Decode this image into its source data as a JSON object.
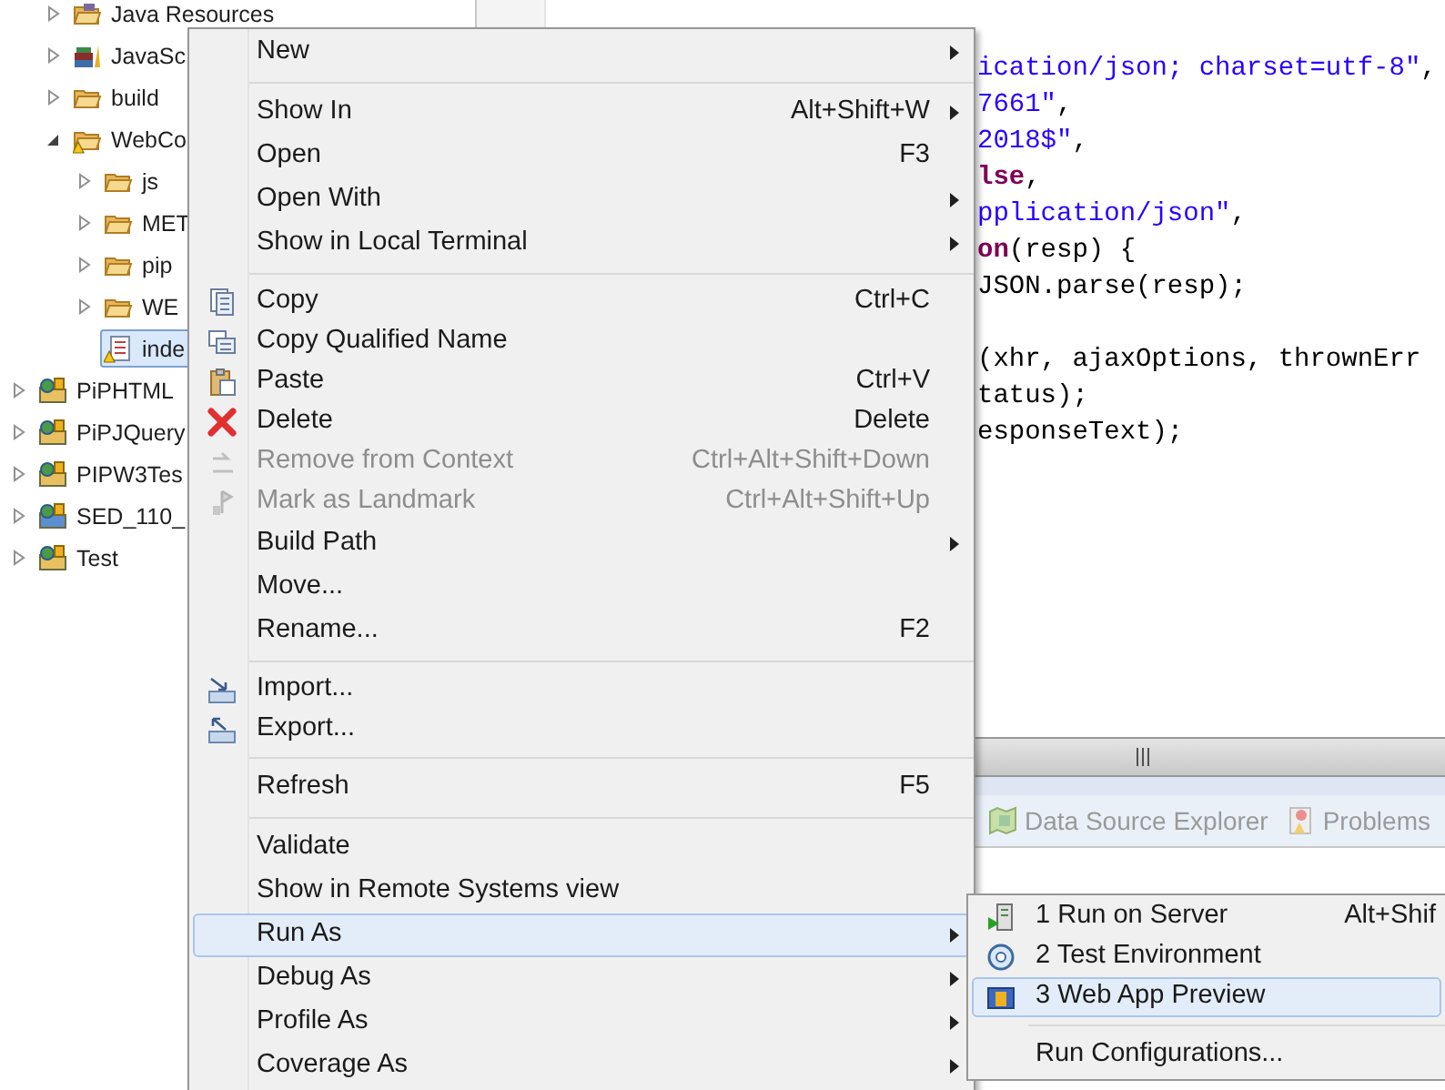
{
  "tree": {
    "project_contents": [
      {
        "label": "Java Resources",
        "kind": "java-resources",
        "expanded": false,
        "selected": false
      },
      {
        "label": "JavaSc",
        "kind": "library",
        "expanded": false,
        "selected": false
      },
      {
        "label": "build",
        "kind": "folder",
        "expanded": false,
        "selected": false
      },
      {
        "label": "WebCo",
        "kind": "warn-folder",
        "expanded": true,
        "selected": false,
        "children": [
          {
            "label": "js",
            "kind": "folder",
            "expanded": false,
            "selected": false
          },
          {
            "label": "MET",
            "kind": "folder",
            "expanded": false,
            "selected": false
          },
          {
            "label": "pip",
            "kind": "folder",
            "expanded": false,
            "selected": false
          },
          {
            "label": "WE",
            "kind": "folder",
            "expanded": false,
            "selected": false
          },
          {
            "label": "inde",
            "kind": "file",
            "selected": true
          }
        ]
      }
    ],
    "projects": [
      {
        "label": "PiPHTML",
        "kind": "project",
        "expanded": false,
        "selected": false
      },
      {
        "label": "PiPJQuery",
        "kind": "project",
        "expanded": false,
        "selected": false
      },
      {
        "label": "PIPW3Tes",
        "kind": "project",
        "expanded": false,
        "selected": false
      },
      {
        "label": "SED_110_",
        "kind": "project-alt",
        "expanded": false,
        "selected": false
      },
      {
        "label": "Test",
        "kind": "project",
        "expanded": false,
        "selected": false
      }
    ]
  },
  "editor": {
    "upper_lines": [
      [
        {
          "kind": "string",
          "text": "ication/json; charset=utf-8\""
        },
        {
          "kind": "plain",
          "text": ","
        }
      ],
      [
        {
          "kind": "string",
          "text": "7661\""
        },
        {
          "kind": "plain",
          "text": ","
        }
      ],
      [
        {
          "kind": "string",
          "text": "2018$\""
        },
        {
          "kind": "plain",
          "text": ","
        }
      ],
      [
        {
          "kind": "keyword",
          "text": "lse"
        },
        {
          "kind": "plain",
          "text": ","
        }
      ],
      [
        {
          "kind": "string",
          "text": "pplication/json\""
        },
        {
          "kind": "plain",
          "text": ","
        }
      ],
      [
        {
          "kind": "keyword",
          "text": "on"
        },
        {
          "kind": "plain",
          "text": "(resp) {"
        }
      ],
      [
        {
          "kind": "plain",
          "text": "JSON.parse(resp);"
        }
      ]
    ],
    "lower_lines": [
      [
        {
          "kind": "plain",
          "text": "(xhr, ajaxOptions, thrownErr"
        }
      ],
      [
        {
          "kind": "plain",
          "text": "tatus);"
        }
      ],
      [
        {
          "kind": "plain",
          "text": "esponseText);"
        }
      ]
    ]
  },
  "views": {
    "tabs": [
      {
        "label": "Data Source Explorer",
        "kind": "database"
      },
      {
        "label": "Problems",
        "kind": "problems"
      }
    ]
  },
  "context_menu": [
    {
      "kind": "item",
      "label": "New",
      "submenu": true,
      "disabled": false,
      "selected": false
    },
    {
      "kind": "separator"
    },
    {
      "kind": "item",
      "label": "Show In",
      "shortcut": "Alt+Shift+W",
      "submenu": true,
      "disabled": false,
      "selected": false
    },
    {
      "kind": "item",
      "label": "Open",
      "shortcut": "F3",
      "submenu": false,
      "disabled": false,
      "selected": false
    },
    {
      "kind": "item",
      "label": "Open With",
      "submenu": true,
      "disabled": false,
      "selected": false
    },
    {
      "kind": "item",
      "label": "Show in Local Terminal",
      "submenu": true,
      "disabled": false,
      "selected": false
    },
    {
      "kind": "separator"
    },
    {
      "kind": "item",
      "label": "Copy",
      "shortcut": "Ctrl+C",
      "submenu": false,
      "disabled": false,
      "selected": false
    },
    {
      "kind": "item",
      "label": "Copy Qualified Name",
      "submenu": false,
      "disabled": false,
      "selected": false
    },
    {
      "kind": "item",
      "label": "Paste",
      "shortcut": "Ctrl+V",
      "submenu": false,
      "disabled": false,
      "selected": false
    },
    {
      "kind": "item",
      "label": "Delete",
      "shortcut": "Delete",
      "submenu": false,
      "disabled": false,
      "selected": false
    },
    {
      "kind": "item",
      "label": "Remove from Context",
      "shortcut": "Ctrl+Alt+Shift+Down",
      "submenu": false,
      "disabled": true,
      "selected": false
    },
    {
      "kind": "item",
      "label": "Mark as Landmark",
      "shortcut": "Ctrl+Alt+Shift+Up",
      "submenu": false,
      "disabled": true,
      "selected": false
    },
    {
      "kind": "item",
      "label": "Build Path",
      "submenu": true,
      "disabled": false,
      "selected": false
    },
    {
      "kind": "item",
      "label": "Move...",
      "submenu": false,
      "disabled": false,
      "selected": false
    },
    {
      "kind": "item",
      "label": "Rename...",
      "shortcut": "F2",
      "submenu": false,
      "disabled": false,
      "selected": false
    },
    {
      "kind": "separator"
    },
    {
      "kind": "item",
      "label": "Import...",
      "submenu": false,
      "disabled": false,
      "selected": false
    },
    {
      "kind": "item",
      "label": "Export...",
      "submenu": false,
      "disabled": false,
      "selected": false
    },
    {
      "kind": "separator"
    },
    {
      "kind": "item",
      "label": "Refresh",
      "shortcut": "F5",
      "submenu": false,
      "disabled": false,
      "selected": false
    },
    {
      "kind": "separator"
    },
    {
      "kind": "item",
      "label": "Validate",
      "submenu": false,
      "disabled": false,
      "selected": false
    },
    {
      "kind": "item",
      "label": "Show in Remote Systems view",
      "submenu": false,
      "disabled": false,
      "selected": false
    },
    {
      "kind": "item",
      "label": "Run As",
      "submenu": true,
      "disabled": false,
      "selected": true
    },
    {
      "kind": "item",
      "label": "Debug As",
      "submenu": true,
      "disabled": false,
      "selected": false
    },
    {
      "kind": "item",
      "label": "Profile As",
      "submenu": true,
      "disabled": false,
      "selected": false
    },
    {
      "kind": "item",
      "label": "Coverage As",
      "submenu": true,
      "disabled": false,
      "selected": false
    }
  ],
  "run_as_menu": [
    {
      "kind": "item",
      "label": "1 Run on Server",
      "shortcut": "Alt+Shif",
      "selected": false
    },
    {
      "kind": "item",
      "label": "2 Test Environment",
      "selected": false
    },
    {
      "kind": "item",
      "label": "3 Web App Preview",
      "selected": true
    },
    {
      "kind": "separator"
    },
    {
      "kind": "item",
      "label": "Run Configurations...",
      "selected": false
    }
  ]
}
